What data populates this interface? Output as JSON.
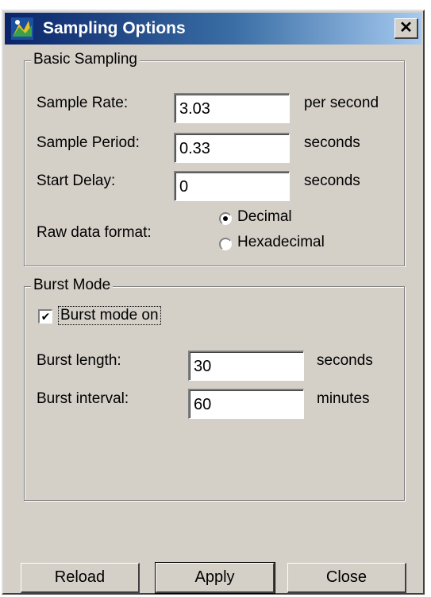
{
  "window": {
    "title": "Sampling Options",
    "close_glyph": "✕"
  },
  "basic_sampling": {
    "legend": "Basic Sampling",
    "sample_rate": {
      "label": "Sample Rate:",
      "value": "3.03",
      "unit": "per second"
    },
    "sample_period": {
      "label": "Sample Period:",
      "value": "0.33",
      "unit": "seconds"
    },
    "start_delay": {
      "label": "Start Delay:",
      "value": "0",
      "unit": "seconds"
    },
    "raw_format": {
      "label": "Raw data format:",
      "options": [
        "Decimal",
        "Hexadecimal"
      ],
      "selected": "Decimal"
    }
  },
  "burst_mode": {
    "legend": "Burst Mode",
    "checkbox_label": "Burst mode on",
    "checked": true,
    "burst_length": {
      "label": "Burst length:",
      "value": "30",
      "unit": "seconds"
    },
    "burst_interval": {
      "label": "Burst interval:",
      "value": "60",
      "unit": "minutes"
    }
  },
  "buttons": {
    "reload": "Reload",
    "apply": "Apply",
    "close": "Close"
  },
  "icons": {
    "app": "app-icon",
    "close": "close-icon",
    "check": "check-icon"
  }
}
